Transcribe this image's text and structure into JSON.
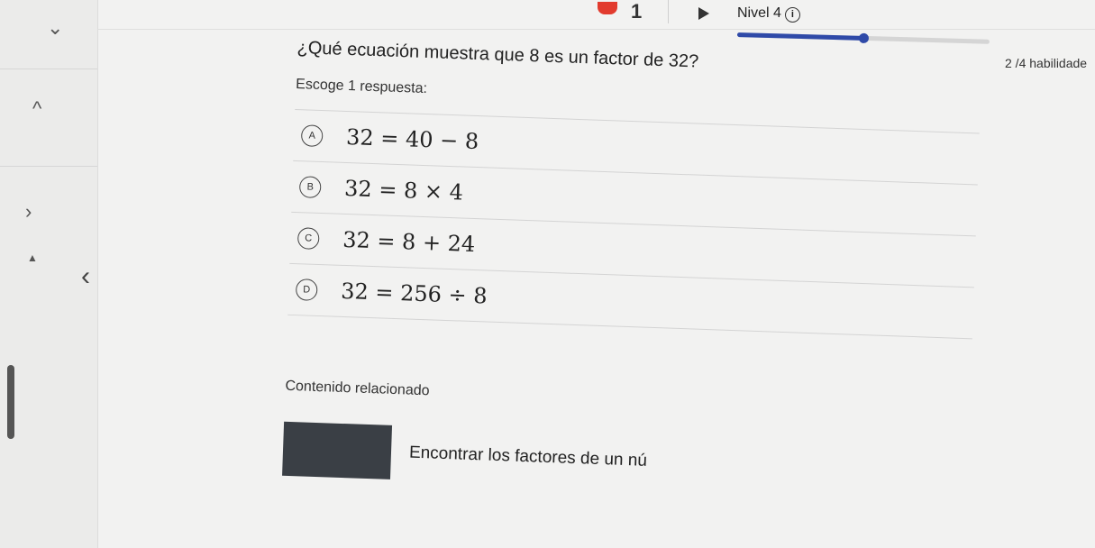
{
  "header": {
    "recording_count": "1",
    "level_label": "Nivel 4",
    "info_glyph": "i",
    "progress": {
      "fraction": 0.5
    },
    "skills_text": "2 /4 habilidade"
  },
  "sidebar": {
    "icons": [
      "chevron-down-icon",
      "chevron-up-icon",
      "chevron-right-icon",
      "triangle-up-icon"
    ],
    "back_icon": "chevron-left-icon"
  },
  "question": {
    "text": "¿Qué ecuación muestra que 8 es un factor de 32?",
    "instruction": "Escoge 1 respuesta:",
    "choices": [
      {
        "letter": "A",
        "text": "32 = 40 − 8"
      },
      {
        "letter": "B",
        "text": "32 = 8 × 4"
      },
      {
        "letter": "C",
        "text": "32 = 8 + 24"
      },
      {
        "letter": "D",
        "text": "32 = 256 ÷ 8"
      }
    ]
  },
  "related": {
    "heading": "Contenido relacionado",
    "item_title": "Encontrar los factores de un nú"
  },
  "colors": {
    "accent": "#2f4aa8",
    "record": "#e23b2e",
    "background": "#f2f2f1"
  }
}
